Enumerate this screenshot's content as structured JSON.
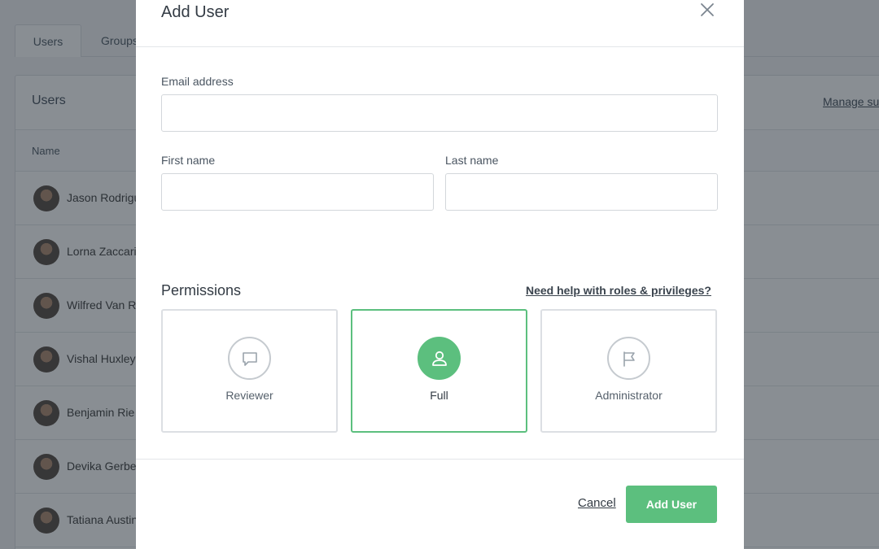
{
  "background": {
    "tabs": [
      "Users",
      "Groups"
    ],
    "panel_title": "Users",
    "manage_link": "Manage su",
    "column_name": "Name",
    "users": [
      "Jason Rodriguez",
      "Lorna Zaccari",
      "Wilfred Van R",
      "Vishal Huxley",
      "Benjamin Rie",
      "Devika Gerbe",
      "Tatiana Austin"
    ]
  },
  "modal": {
    "title": "Add User",
    "email_label": "Email address",
    "email_value": "",
    "first_name_label": "First name",
    "first_name_value": "",
    "last_name_label": "Last name",
    "last_name_value": "",
    "permissions_title": "Permissions",
    "help_link": "Need help with roles & privileges?",
    "permissions": [
      {
        "label": "Reviewer",
        "icon": "chat-bubble-icon",
        "selected": false
      },
      {
        "label": "Full",
        "icon": "user-icon",
        "selected": true
      },
      {
        "label": "Administrator",
        "icon": "flag-icon",
        "selected": false
      }
    ],
    "cancel_label": "Cancel",
    "submit_label": "Add User"
  },
  "colors": {
    "accent": "#5cbf7e",
    "overlay": "rgba(20,30,40,0.5)"
  }
}
